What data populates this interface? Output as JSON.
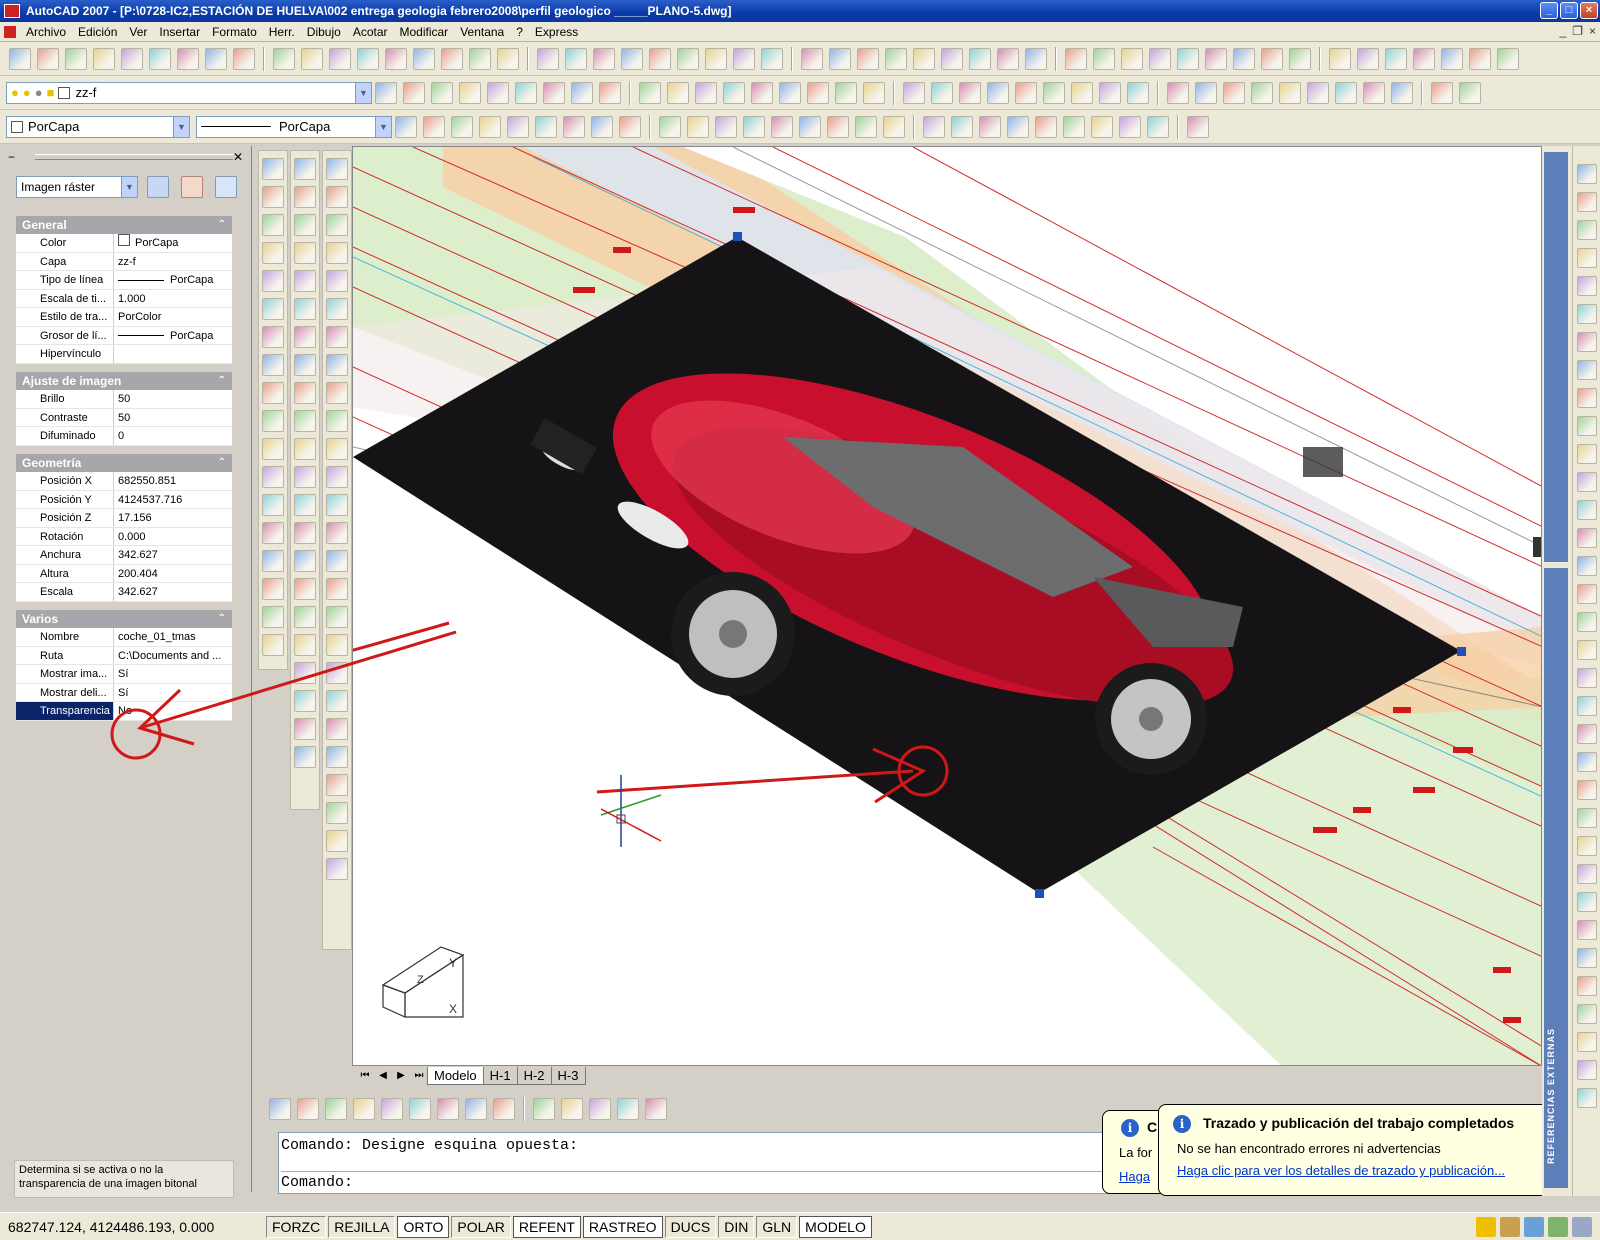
{
  "window": {
    "title": "AutoCAD 2007 - [P:\\0728-IC2,ESTACIÓN DE HUELVA\\002 entrega geologia febrero2008\\perfil geologico _____PLANO-5.dwg]"
  },
  "menu": [
    "Archivo",
    "Edición",
    "Ver",
    "Insertar",
    "Formato",
    "Herr.",
    "Dibujo",
    "Acotar",
    "Modificar",
    "Ventana",
    "?",
    "Express"
  ],
  "layer_combo": {
    "value": "zz-f"
  },
  "props_toolbar": {
    "color": "PorCapa",
    "linetype": "PorCapa"
  },
  "properties": {
    "object_type": "Imagen ráster",
    "sections": {
      "general": {
        "title": "General",
        "rows": [
          {
            "k": "Color",
            "v": "PorCapa"
          },
          {
            "k": "Capa",
            "v": "zz-f"
          },
          {
            "k": "Tipo de línea",
            "v": "PorCapa"
          },
          {
            "k": "Escala de ti...",
            "v": "1.000"
          },
          {
            "k": "Estilo de tra...",
            "v": "PorColor"
          },
          {
            "k": "Grosor de lí...",
            "v": "PorCapa"
          },
          {
            "k": "Hipervínculo",
            "v": ""
          }
        ]
      },
      "image_adjust": {
        "title": "Ajuste de imagen",
        "rows": [
          {
            "k": "Brillo",
            "v": "50"
          },
          {
            "k": "Contraste",
            "v": "50"
          },
          {
            "k": "Difuminado",
            "v": "0"
          }
        ]
      },
      "geometry": {
        "title": "Geometría",
        "rows": [
          {
            "k": "Posición X",
            "v": "682550.851"
          },
          {
            "k": "Posición Y",
            "v": "4124537.716"
          },
          {
            "k": "Posición Z",
            "v": "17.156"
          },
          {
            "k": "Rotación",
            "v": "0.000"
          },
          {
            "k": "Anchura",
            "v": "342.627"
          },
          {
            "k": "Altura",
            "v": "200.404"
          },
          {
            "k": "Escala",
            "v": "342.627"
          }
        ]
      },
      "misc": {
        "title": "Varios",
        "rows": [
          {
            "k": "Nombre",
            "v": "coche_01_tmas"
          },
          {
            "k": "Ruta",
            "v": "C:\\Documents and ..."
          },
          {
            "k": "Mostrar ima...",
            "v": "Sí"
          },
          {
            "k": "Mostrar deli...",
            "v": "Sí"
          },
          {
            "k": "Transparencia",
            "v": "No"
          }
        ]
      }
    },
    "description": "Determina si se activa o no la transparencia de una imagen bitonal"
  },
  "tabs": [
    "Modelo",
    "H-1",
    "H-2",
    "H-3"
  ],
  "command": {
    "line1": "Comando: Designe esquina opuesta:",
    "line2": "Comando:"
  },
  "balloon": {
    "title": "Trazado y publicación del trabajo completados",
    "message": "No se han encontrado errores ni advertencias",
    "link": "Haga clic para ver los detalles de trazado y publicación...",
    "back_title_fragment": "C",
    "back_msg_fragment": "La for",
    "back_link_fragment": "Haga"
  },
  "refpanel_label": "REFERENCIAS EXTERNAS",
  "status": {
    "coords": "682747.124, 4124486.193, 0.000",
    "buttons": [
      "FORZC",
      "REJILLA",
      "ORTO",
      "POLAR",
      "REFENT",
      "RASTREO",
      "DUCS",
      "DIN",
      "GLN",
      "MODELO"
    ]
  },
  "colors": {
    "title_blue": "#0a3aa8",
    "accent_red": "#d01818",
    "car_red": "#c8102e"
  },
  "icons": [
    "undo-icon",
    "redo-icon",
    "zoom-icon",
    "pan-icon",
    "help-icon",
    "line-icon",
    "circle-icon",
    "arc-icon",
    "hatch-icon",
    "text-icon",
    "move-icon",
    "rotate-icon",
    "erase-icon",
    "info-icon"
  ]
}
